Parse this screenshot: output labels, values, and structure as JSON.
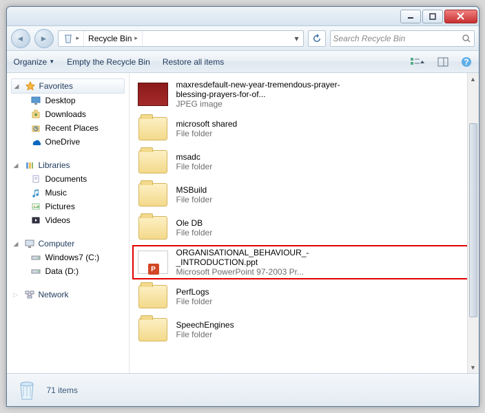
{
  "titlebar": {
    "min": "_",
    "max": "☐",
    "close": "✕"
  },
  "nav": {
    "location": "Recycle Bin",
    "chevron": "▸",
    "searchPlaceholder": "Search Recycle Bin"
  },
  "toolbar": {
    "organize": "Organize",
    "empty": "Empty the Recycle Bin",
    "restore": "Restore all items"
  },
  "sidebar": {
    "favorites": {
      "label": "Favorites",
      "items": [
        {
          "icon": "desktop",
          "label": "Desktop"
        },
        {
          "icon": "downloads",
          "label": "Downloads"
        },
        {
          "icon": "recent",
          "label": "Recent Places"
        },
        {
          "icon": "onedrive",
          "label": "OneDrive"
        }
      ]
    },
    "libraries": {
      "label": "Libraries",
      "items": [
        {
          "icon": "doc",
          "label": "Documents"
        },
        {
          "icon": "music",
          "label": "Music"
        },
        {
          "icon": "pic",
          "label": "Pictures"
        },
        {
          "icon": "vid",
          "label": "Videos"
        }
      ]
    },
    "computer": {
      "label": "Computer",
      "items": [
        {
          "icon": "drive",
          "label": "Windows7 (C:)"
        },
        {
          "icon": "drive",
          "label": "Data (D:)"
        }
      ]
    },
    "network": {
      "label": "Network"
    }
  },
  "items": [
    {
      "kind": "image",
      "name": "maxresdefault-new-year-tremendous-prayer-blessing-prayers-for-of...",
      "type": "JPEG image"
    },
    {
      "kind": "folder",
      "name": "microsoft shared",
      "type": "File folder"
    },
    {
      "kind": "folder",
      "name": "msadc",
      "type": "File folder"
    },
    {
      "kind": "folder",
      "name": "MSBuild",
      "type": "File folder"
    },
    {
      "kind": "folder",
      "name": "Ole DB",
      "type": "File folder"
    },
    {
      "kind": "ppt",
      "name": "ORGANISATIONAL_BEHAVIOUR_-_INTRODUCTION.ppt",
      "type": "Microsoft PowerPoint 97-2003 Pr...",
      "highlight": true
    },
    {
      "kind": "folder",
      "name": "PerfLogs",
      "type": "File folder"
    },
    {
      "kind": "folder",
      "name": "SpeechEngines",
      "type": "File folder"
    }
  ],
  "status": {
    "count": "71 items"
  }
}
